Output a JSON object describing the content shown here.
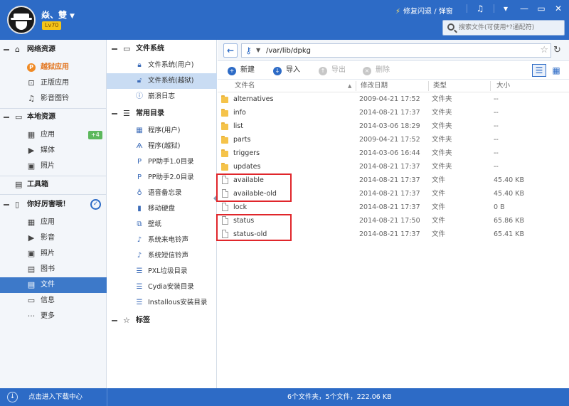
{
  "window": {
    "user_name": "焱、雙",
    "level": "Lv70",
    "repair_label": "修复闪退 / 弹窗",
    "search_placeholder": "搜索文件(可使用*?通配符)"
  },
  "sidebar": {
    "network": {
      "title": "网络资源",
      "items": [
        {
          "label": "越狱应用",
          "icon": "jailbreak-app-icon"
        },
        {
          "label": "正版应用",
          "icon": "bag-icon"
        },
        {
          "label": "影音图铃",
          "icon": "music-icon"
        }
      ]
    },
    "local": {
      "title": "本地资源",
      "items": [
        {
          "label": "应用",
          "icon": "grid-icon",
          "badge": "+4"
        },
        {
          "label": "媒体",
          "icon": "video-icon"
        },
        {
          "label": "照片",
          "icon": "photo-icon"
        }
      ]
    },
    "toolbox": {
      "title": "工具箱"
    },
    "device": {
      "title": "你好厉害哦！",
      "items": [
        {
          "label": "应用",
          "icon": "grid-icon"
        },
        {
          "label": "影音",
          "icon": "video-icon"
        },
        {
          "label": "照片",
          "icon": "photo-icon"
        },
        {
          "label": "图书",
          "icon": "book-icon"
        },
        {
          "label": "文件",
          "icon": "file-icon"
        },
        {
          "label": "信息",
          "icon": "message-icon"
        },
        {
          "label": "更多",
          "icon": "more-icon"
        }
      ]
    }
  },
  "tree": {
    "filesystem": {
      "title": "文件系统",
      "items": [
        {
          "label": "文件系统(用户)"
        },
        {
          "label": "文件系统(越狱)"
        },
        {
          "label": "崩溃日志"
        }
      ]
    },
    "common": {
      "title": "常用目录",
      "items": [
        {
          "label": "程序(用户)"
        },
        {
          "label": "程序(越狱)"
        },
        {
          "label": "PP助手1.0目录"
        },
        {
          "label": "PP助手2.0目录"
        },
        {
          "label": "语音备忘录"
        },
        {
          "label": "移动硬盘"
        },
        {
          "label": "壁纸"
        },
        {
          "label": "系统来电铃声"
        },
        {
          "label": "系统短信铃声"
        },
        {
          "label": "PXL垃圾目录"
        },
        {
          "label": "Cydia安装目录"
        },
        {
          "label": "Installous安装目录"
        }
      ]
    },
    "bookmarks": {
      "title": "标签"
    }
  },
  "address": {
    "path": "/var/lib/dpkg"
  },
  "toolbar": {
    "new_label": "新建",
    "import_label": "导入",
    "export_label": "导出",
    "delete_label": "删除"
  },
  "table": {
    "headers": {
      "name": "文件名",
      "modified": "修改日期",
      "type": "类型",
      "size": "大小"
    },
    "rows": [
      {
        "name": "alternatives",
        "modified": "2009-04-21 17:52",
        "type": "文件夹",
        "size": "--",
        "kind": "folder"
      },
      {
        "name": "info",
        "modified": "2014-08-21 17:37",
        "type": "文件夹",
        "size": "--",
        "kind": "folder"
      },
      {
        "name": "list",
        "modified": "2014-03-06 18:29",
        "type": "文件夹",
        "size": "--",
        "kind": "folder"
      },
      {
        "name": "parts",
        "modified": "2009-04-21 17:52",
        "type": "文件夹",
        "size": "--",
        "kind": "folder"
      },
      {
        "name": "triggers",
        "modified": "2014-03-06 16:44",
        "type": "文件夹",
        "size": "--",
        "kind": "folder"
      },
      {
        "name": "updates",
        "modified": "2014-08-21 17:37",
        "type": "文件夹",
        "size": "--",
        "kind": "folder"
      },
      {
        "name": "available",
        "modified": "2014-08-21 17:37",
        "type": "文件",
        "size": "45.40 KB",
        "kind": "file"
      },
      {
        "name": "available-old",
        "modified": "2014-08-21 17:37",
        "type": "文件",
        "size": "45.40 KB",
        "kind": "file"
      },
      {
        "name": "lock",
        "modified": "2014-08-21 17:37",
        "type": "文件",
        "size": "0 B",
        "kind": "file"
      },
      {
        "name": "status",
        "modified": "2014-08-21 17:50",
        "type": "文件",
        "size": "65.86 KB",
        "kind": "file"
      },
      {
        "name": "status-old",
        "modified": "2014-08-21 17:37",
        "type": "文件",
        "size": "65.41 KB",
        "kind": "file"
      }
    ]
  },
  "statusbar": {
    "download_label": "点击进入下载中心",
    "summary": "6个文件夹，5个文件，222.06 KB"
  },
  "colors": {
    "accent": "#2d6bc6",
    "selected": "#3d79c9",
    "highlight_box": "#e0262b",
    "jailbreak_orange": "#f08a24"
  }
}
